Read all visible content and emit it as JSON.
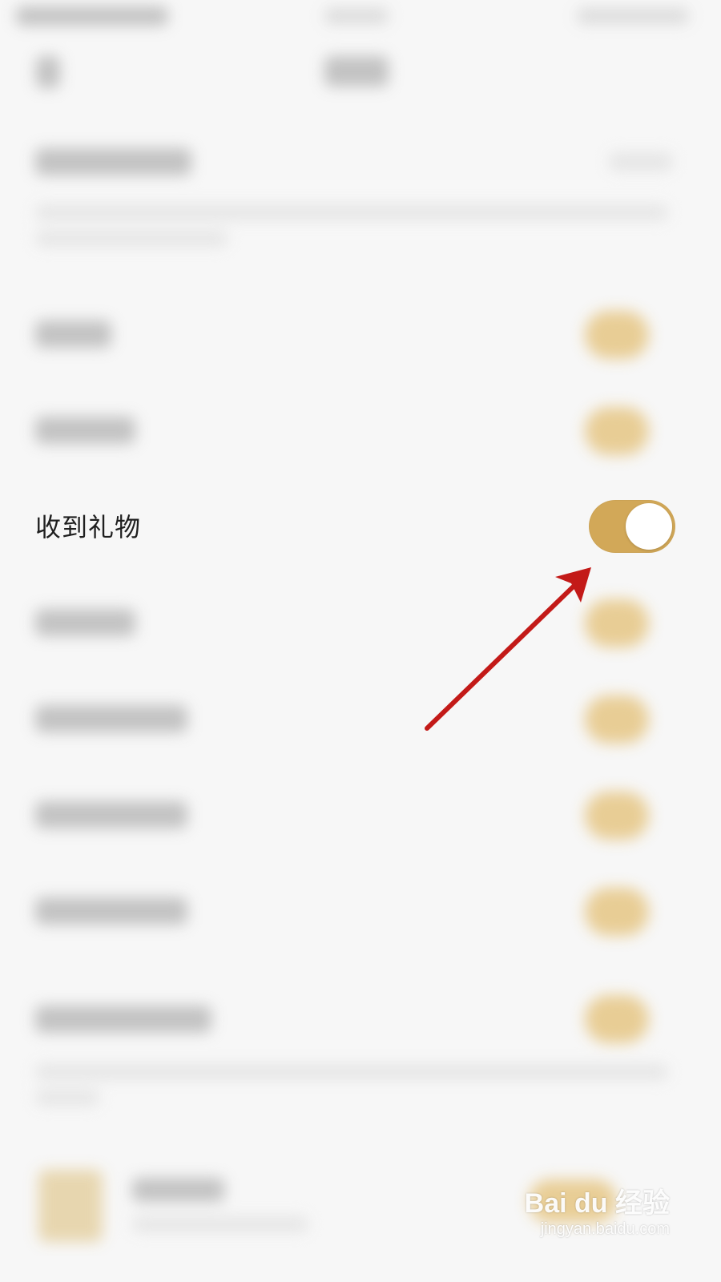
{
  "settings": {
    "focused_row": {
      "label": "收到礼物",
      "toggle_on": true
    }
  },
  "colors": {
    "background": "#f7f7f7",
    "toggle_on": "#d2a858",
    "toggle_knob": "#ffffff",
    "annotation_arrow": "#c31a18"
  },
  "watermark": {
    "brand": "Bai du 经验",
    "url": "jingyan.baidu.com"
  }
}
